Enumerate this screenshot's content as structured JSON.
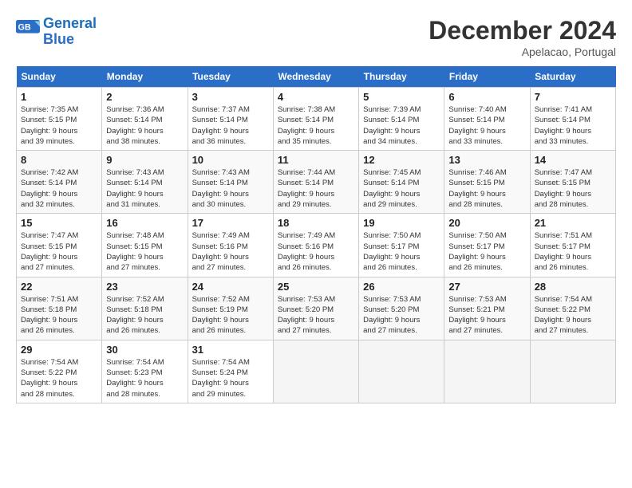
{
  "header": {
    "logo_line1": "General",
    "logo_line2": "Blue",
    "month_title": "December 2024",
    "location": "Apelacao, Portugal"
  },
  "weekdays": [
    "Sunday",
    "Monday",
    "Tuesday",
    "Wednesday",
    "Thursday",
    "Friday",
    "Saturday"
  ],
  "weeks": [
    [
      {
        "day": 1,
        "info": "Sunrise: 7:35 AM\nSunset: 5:15 PM\nDaylight: 9 hours\nand 39 minutes."
      },
      {
        "day": 2,
        "info": "Sunrise: 7:36 AM\nSunset: 5:14 PM\nDaylight: 9 hours\nand 38 minutes."
      },
      {
        "day": 3,
        "info": "Sunrise: 7:37 AM\nSunset: 5:14 PM\nDaylight: 9 hours\nand 36 minutes."
      },
      {
        "day": 4,
        "info": "Sunrise: 7:38 AM\nSunset: 5:14 PM\nDaylight: 9 hours\nand 35 minutes."
      },
      {
        "day": 5,
        "info": "Sunrise: 7:39 AM\nSunset: 5:14 PM\nDaylight: 9 hours\nand 34 minutes."
      },
      {
        "day": 6,
        "info": "Sunrise: 7:40 AM\nSunset: 5:14 PM\nDaylight: 9 hours\nand 33 minutes."
      },
      {
        "day": 7,
        "info": "Sunrise: 7:41 AM\nSunset: 5:14 PM\nDaylight: 9 hours\nand 33 minutes."
      }
    ],
    [
      {
        "day": 8,
        "info": "Sunrise: 7:42 AM\nSunset: 5:14 PM\nDaylight: 9 hours\nand 32 minutes."
      },
      {
        "day": 9,
        "info": "Sunrise: 7:43 AM\nSunset: 5:14 PM\nDaylight: 9 hours\nand 31 minutes."
      },
      {
        "day": 10,
        "info": "Sunrise: 7:43 AM\nSunset: 5:14 PM\nDaylight: 9 hours\nand 30 minutes."
      },
      {
        "day": 11,
        "info": "Sunrise: 7:44 AM\nSunset: 5:14 PM\nDaylight: 9 hours\nand 29 minutes."
      },
      {
        "day": 12,
        "info": "Sunrise: 7:45 AM\nSunset: 5:14 PM\nDaylight: 9 hours\nand 29 minutes."
      },
      {
        "day": 13,
        "info": "Sunrise: 7:46 AM\nSunset: 5:15 PM\nDaylight: 9 hours\nand 28 minutes."
      },
      {
        "day": 14,
        "info": "Sunrise: 7:47 AM\nSunset: 5:15 PM\nDaylight: 9 hours\nand 28 minutes."
      }
    ],
    [
      {
        "day": 15,
        "info": "Sunrise: 7:47 AM\nSunset: 5:15 PM\nDaylight: 9 hours\nand 27 minutes."
      },
      {
        "day": 16,
        "info": "Sunrise: 7:48 AM\nSunset: 5:15 PM\nDaylight: 9 hours\nand 27 minutes."
      },
      {
        "day": 17,
        "info": "Sunrise: 7:49 AM\nSunset: 5:16 PM\nDaylight: 9 hours\nand 27 minutes."
      },
      {
        "day": 18,
        "info": "Sunrise: 7:49 AM\nSunset: 5:16 PM\nDaylight: 9 hours\nand 26 minutes."
      },
      {
        "day": 19,
        "info": "Sunrise: 7:50 AM\nSunset: 5:17 PM\nDaylight: 9 hours\nand 26 minutes."
      },
      {
        "day": 20,
        "info": "Sunrise: 7:50 AM\nSunset: 5:17 PM\nDaylight: 9 hours\nand 26 minutes."
      },
      {
        "day": 21,
        "info": "Sunrise: 7:51 AM\nSunset: 5:17 PM\nDaylight: 9 hours\nand 26 minutes."
      }
    ],
    [
      {
        "day": 22,
        "info": "Sunrise: 7:51 AM\nSunset: 5:18 PM\nDaylight: 9 hours\nand 26 minutes."
      },
      {
        "day": 23,
        "info": "Sunrise: 7:52 AM\nSunset: 5:18 PM\nDaylight: 9 hours\nand 26 minutes."
      },
      {
        "day": 24,
        "info": "Sunrise: 7:52 AM\nSunset: 5:19 PM\nDaylight: 9 hours\nand 26 minutes."
      },
      {
        "day": 25,
        "info": "Sunrise: 7:53 AM\nSunset: 5:20 PM\nDaylight: 9 hours\nand 27 minutes."
      },
      {
        "day": 26,
        "info": "Sunrise: 7:53 AM\nSunset: 5:20 PM\nDaylight: 9 hours\nand 27 minutes."
      },
      {
        "day": 27,
        "info": "Sunrise: 7:53 AM\nSunset: 5:21 PM\nDaylight: 9 hours\nand 27 minutes."
      },
      {
        "day": 28,
        "info": "Sunrise: 7:54 AM\nSunset: 5:22 PM\nDaylight: 9 hours\nand 27 minutes."
      }
    ],
    [
      {
        "day": 29,
        "info": "Sunrise: 7:54 AM\nSunset: 5:22 PM\nDaylight: 9 hours\nand 28 minutes."
      },
      {
        "day": 30,
        "info": "Sunrise: 7:54 AM\nSunset: 5:23 PM\nDaylight: 9 hours\nand 28 minutes."
      },
      {
        "day": 31,
        "info": "Sunrise: 7:54 AM\nSunset: 5:24 PM\nDaylight: 9 hours\nand 29 minutes."
      },
      null,
      null,
      null,
      null
    ]
  ]
}
